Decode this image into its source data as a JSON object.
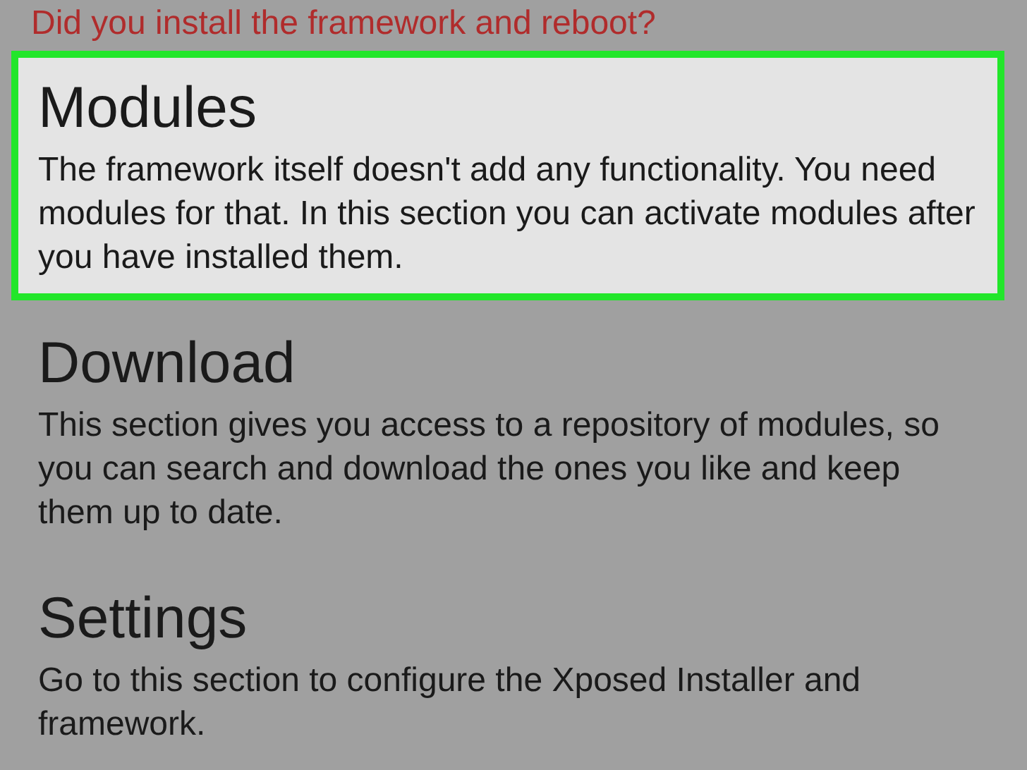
{
  "warning": "Did you install the framework and reboot?",
  "sections": [
    {
      "title": "Modules",
      "description": "The framework itself doesn't add any functionality. You need modules for that. In this section you can activate modules after you have installed them.",
      "highlighted": true
    },
    {
      "title": "Download",
      "description": "This section gives you access to a repository of modules, so you can search and download the ones you like and keep them up to date.",
      "highlighted": false
    },
    {
      "title": "Settings",
      "description": "Go to this section to configure the Xposed Installer and framework.",
      "highlighted": false
    }
  ]
}
